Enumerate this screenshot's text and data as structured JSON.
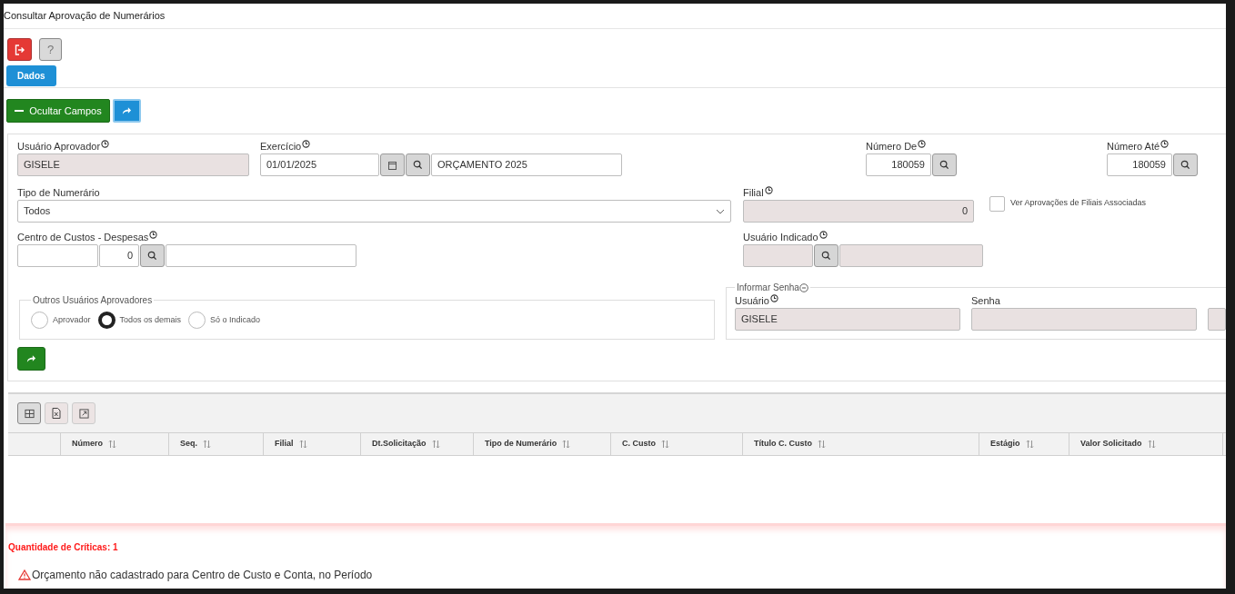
{
  "window": {
    "title": "Consultar Aprovação de Numerários"
  },
  "toolbar": [
    {
      "kind": "exit"
    },
    {
      "kind": "help",
      "label": "?"
    }
  ],
  "tabs": [
    {
      "label": "Dados",
      "selected": true
    }
  ],
  "actions": {
    "toggle": {
      "label": "Ocultar Campos"
    },
    "go": {
      "kind": "forward"
    }
  },
  "form": {
    "aprovador": {
      "label": "Usuário Aprovador",
      "value": "GISELE",
      "disabled": true
    },
    "exercicio": {
      "label": "Exercício",
      "date": "01/01/2025",
      "description": "ORÇAMENTO 2025"
    },
    "numero_de": {
      "label": "Número De",
      "value": "180059"
    },
    "numero_ate": {
      "label": "Número Até",
      "value": "180059"
    },
    "tipo": {
      "label": "Tipo de Numerário",
      "value": "Todos"
    },
    "filial": {
      "label": "Filial",
      "value": "0",
      "disabled": true
    },
    "ver_filiais": {
      "label": "Ver Aprovações de Filiais Associadas",
      "checked": false
    },
    "centro": {
      "label": "Centro de Custos - Despesas",
      "code": "0"
    },
    "indicado": {
      "label": "Usuário Indicado",
      "disabled": true
    },
    "outros": {
      "legend": "Outros Usuários Aprovadores",
      "options": [
        {
          "label": "Aprovador",
          "selected": false
        },
        {
          "label": "Todos os demais",
          "selected": true
        },
        {
          "label": "Só o Indicado",
          "selected": false
        }
      ]
    },
    "senha": {
      "legend": "Informar Senha",
      "user_label": "Usuário",
      "user": "GISELE",
      "password_label": "Senha",
      "disabled": true
    }
  },
  "grid": {
    "tools": [
      {
        "kind": "grid",
        "selected": true
      },
      {
        "kind": "excel",
        "selected": false
      },
      {
        "kind": "export",
        "selected": false
      }
    ],
    "columns": [
      "Número",
      "Seq.",
      "Filial",
      "Dt.Solicitação",
      "Tipo de Numerário",
      "C. Custo",
      "Título C. Custo",
      "Estágio",
      "Valor Solicitado"
    ]
  },
  "critics": {
    "title": "Quantidade de Críticas: 1",
    "items": [
      "Orçamento não cadastrado para Centro de Custo e Conta, no Período"
    ]
  }
}
